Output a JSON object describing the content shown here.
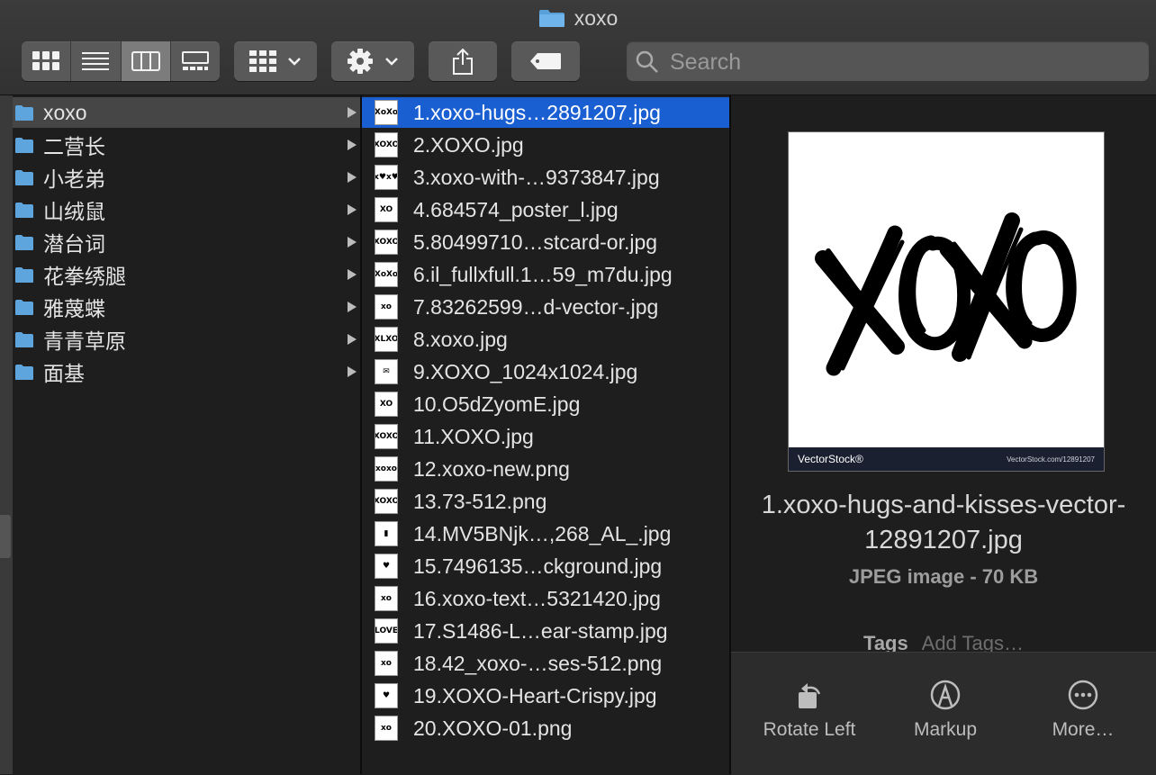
{
  "window": {
    "title": "xoxo"
  },
  "toolbar": {
    "views": [
      {
        "name": "icon-view",
        "icon": "grid-icon"
      },
      {
        "name": "list-view",
        "icon": "list-icon"
      },
      {
        "name": "column-view",
        "icon": "columns-icon",
        "active": true
      },
      {
        "name": "gallery-view",
        "icon": "gallery-icon"
      }
    ],
    "group_icon": "grid-group-icon",
    "action_icon": "gear-icon",
    "share_icon": "share-icon",
    "tag_icon": "tag-icon",
    "search": {
      "placeholder": "Search",
      "value": ""
    }
  },
  "sidebar": {
    "folder_color": "#5ea4dd",
    "items": [
      {
        "label": "xoxo",
        "selected": true
      },
      {
        "label": "二营长"
      },
      {
        "label": "小老弟"
      },
      {
        "label": "山绒鼠"
      },
      {
        "label": "潜台词"
      },
      {
        "label": "花拳绣腿"
      },
      {
        "label": "雅蔑蝶"
      },
      {
        "label": "青青草原"
      },
      {
        "label": "面基"
      }
    ]
  },
  "files": {
    "selection_color": "#1a5fd1",
    "items": [
      {
        "label": "1.xoxo-hugs…2891207.jpg",
        "thumb": "XoXo",
        "selected": true
      },
      {
        "label": "2.XOXO.jpg",
        "thumb": "XOXO"
      },
      {
        "label": "3.xoxo-with-…9373847.jpg",
        "thumb": "x♥x♥"
      },
      {
        "label": "4.684574_poster_l.jpg",
        "thumb": "XO"
      },
      {
        "label": "5.80499710…stcard-or.jpg",
        "thumb": "XOXO"
      },
      {
        "label": "6.il_fullxfull.1…59_m7du.jpg",
        "thumb": "XoXo"
      },
      {
        "label": "7.83262599…d-vector-.jpg",
        "thumb": "xo"
      },
      {
        "label": "8.xoxo.jpg",
        "thumb": "XLXO"
      },
      {
        "label": "9.XOXO_1024x1024.jpg",
        "thumb": "✉"
      },
      {
        "label": "10.O5dZyomE.jpg",
        "thumb": "XO"
      },
      {
        "label": "11.XOXO.jpg",
        "thumb": "XOXO"
      },
      {
        "label": "12.xoxo-new.png",
        "thumb": "xoxo"
      },
      {
        "label": "13.73-512.png",
        "thumb": "XOXO"
      },
      {
        "label": "14.MV5BNjk…,268_AL_.jpg",
        "thumb": "▮"
      },
      {
        "label": "15.7496135…ckground.jpg",
        "thumb": "♥"
      },
      {
        "label": "16.xoxo-text…5321420.jpg",
        "thumb": "xo"
      },
      {
        "label": "17.S1486-L…ear-stamp.jpg",
        "thumb": "LOVE"
      },
      {
        "label": "18.42_xoxo-…ses-512.png",
        "thumb": "xo"
      },
      {
        "label": "19.XOXO-Heart-Crispy.jpg",
        "thumb": "♥"
      },
      {
        "label": "20.XOXO-01.png",
        "thumb": "xo"
      }
    ]
  },
  "preview": {
    "image_text": "XOXO",
    "watermark_brand": "VectorStock®",
    "watermark_url": "VectorStock.com/12891207",
    "file_name": "1.xoxo-hugs-and-kisses-vector-12891207.jpg",
    "file_kind": "JPEG image - 70 KB",
    "tags_label": "Tags",
    "tags_placeholder": "Add Tags…",
    "actions": [
      {
        "label": "Rotate Left",
        "icon": "rotate-left-icon"
      },
      {
        "label": "Markup",
        "icon": "markup-icon"
      },
      {
        "label": "More…",
        "icon": "more-icon"
      }
    ]
  }
}
